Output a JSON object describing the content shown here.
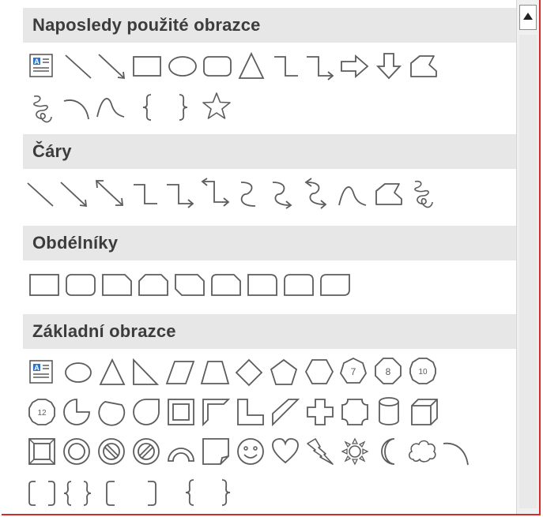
{
  "sections": [
    {
      "id": "recent",
      "title": "Naposledy použité obrazce"
    },
    {
      "id": "lines",
      "title": "Čáry"
    },
    {
      "id": "rectangles",
      "title": "Obdélníky"
    },
    {
      "id": "basic",
      "title": "Základní obrazce"
    }
  ],
  "octagon_labels": {
    "seven": "7",
    "eight": "8",
    "ten": "10",
    "twelve": "12"
  },
  "textbox_label": "A",
  "colors": {
    "header_bg": "#e7e7e7",
    "header_text": "#3c3c3c",
    "shape_stroke": "#5c5c5c",
    "frame_border": "#d42a2a",
    "textbox_accent": "#2e75c8"
  },
  "icons": {
    "scroll_up": "triangle-up-icon",
    "shapes": [
      "text-box-icon",
      "line-icon",
      "arrow-line-icon",
      "rectangle-icon",
      "oval-icon",
      "rounded-rectangle-icon",
      "triangle-icon",
      "elbow-connector-icon",
      "elbow-arrow-connector-icon",
      "right-arrow-icon",
      "down-arrow-icon",
      "freeform-icon",
      "scribble-icon",
      "arc-icon",
      "curve-icon",
      "left-brace-icon",
      "right-brace-icon",
      "star-icon"
    ]
  }
}
